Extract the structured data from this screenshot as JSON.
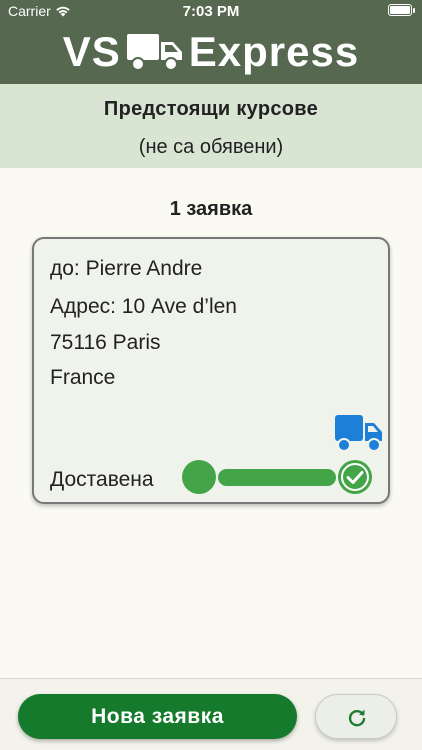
{
  "status_bar": {
    "carrier": "Carrier",
    "time": "7:03 PM"
  },
  "brand": {
    "left": "VS",
    "right": "Express"
  },
  "section": {
    "title": "Предстоящи курсове",
    "note": "(не са обявени)"
  },
  "count_label": "1 заявка",
  "order": {
    "recipient": "до: Pierre Andre",
    "address_line1": "Адрес: 10 Ave d’len",
    "address_line2": "75116 Paris",
    "address_line3": "France",
    "status": "Доставена",
    "progress_fraction": 1.0
  },
  "actions": {
    "new_request": "Нова заявка",
    "refresh_icon": "refresh-icon"
  },
  "colors": {
    "header": "#56684f",
    "subheader": "#d9e5d3",
    "accent_green": "#43a448",
    "button_green": "#157a2c",
    "truck_blue": "#1e7fd8"
  }
}
